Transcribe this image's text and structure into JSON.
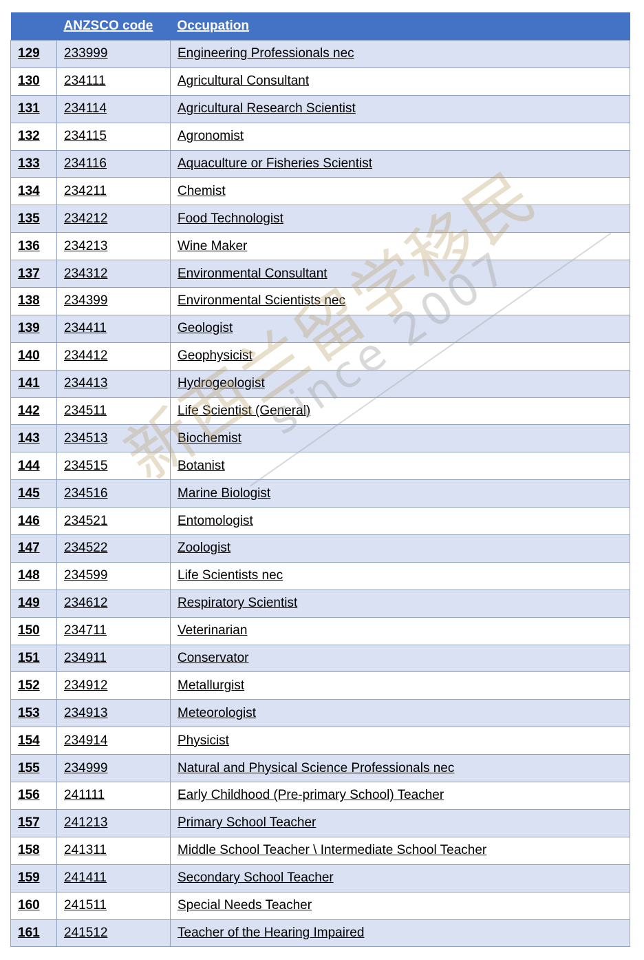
{
  "table": {
    "headers": {
      "number": "",
      "code": "ANZSCO code",
      "occupation": "Occupation"
    },
    "rows": [
      {
        "no": "129",
        "code": "233999",
        "occupation": "Engineering Professionals nec"
      },
      {
        "no": "130",
        "code": "234111",
        "occupation": "Agricultural Consultant"
      },
      {
        "no": "131",
        "code": "234114",
        "occupation": "Agricultural Research Scientist"
      },
      {
        "no": "132",
        "code": "234115",
        "occupation": "Agronomist"
      },
      {
        "no": "133",
        "code": "234116",
        "occupation": "Aquaculture or Fisheries Scientist"
      },
      {
        "no": "134",
        "code": "234211",
        "occupation": "Chemist"
      },
      {
        "no": "135",
        "code": "234212",
        "occupation": "Food Technologist"
      },
      {
        "no": "136",
        "code": "234213",
        "occupation": "Wine Maker"
      },
      {
        "no": "137",
        "code": "234312",
        "occupation": "Environmental Consultant"
      },
      {
        "no": "138",
        "code": "234399",
        "occupation": "Environmental Scientists nec"
      },
      {
        "no": "139",
        "code": "234411",
        "occupation": "Geologist"
      },
      {
        "no": "140",
        "code": "234412",
        "occupation": "Geophysicist"
      },
      {
        "no": "141",
        "code": "234413",
        "occupation": "Hydrogeologist"
      },
      {
        "no": "142",
        "code": "234511",
        "occupation": "Life Scientist (General)"
      },
      {
        "no": "143",
        "code": "234513",
        "occupation": "Biochemist"
      },
      {
        "no": "144",
        "code": "234515",
        "occupation": "Botanist"
      },
      {
        "no": "145",
        "code": "234516",
        "occupation": "Marine Biologist"
      },
      {
        "no": "146",
        "code": "234521",
        "occupation": "Entomologist"
      },
      {
        "no": "147",
        "code": "234522",
        "occupation": "Zoologist"
      },
      {
        "no": "148",
        "code": "234599",
        "occupation": "Life Scientists nec"
      },
      {
        "no": "149",
        "code": "234612",
        "occupation": "Respiratory Scientist"
      },
      {
        "no": "150",
        "code": "234711",
        "occupation": "Veterinarian"
      },
      {
        "no": "151",
        "code": "234911",
        "occupation": "Conservator"
      },
      {
        "no": "152",
        "code": "234912",
        "occupation": "Metallurgist"
      },
      {
        "no": "153",
        "code": "234913",
        "occupation": "Meteorologist"
      },
      {
        "no": "154",
        "code": "234914",
        "occupation": "Physicist"
      },
      {
        "no": "155",
        "code": "234999",
        "occupation": "Natural and Physical Science Professionals nec"
      },
      {
        "no": "156",
        "code": "241111",
        "occupation": "Early Childhood (Pre-primary School) Teacher"
      },
      {
        "no": "157",
        "code": "241213",
        "occupation": "Primary School Teacher"
      },
      {
        "no": "158",
        "code": "241311",
        "occupation": "Middle School Teacher \\ Intermediate School Teacher"
      },
      {
        "no": "159",
        "code": "241411",
        "occupation": "Secondary School Teacher"
      },
      {
        "no": "160",
        "code": "241511",
        "occupation": "Special Needs Teacher"
      },
      {
        "no": "161",
        "code": "241512",
        "occupation": "Teacher of the Hearing Impaired"
      }
    ]
  },
  "watermark": {
    "chinese": "新西兰留学移民",
    "english": "since 2007"
  },
  "colors": {
    "header_bg": "#4472c4",
    "band_bg": "#d9e1f2",
    "border": "#8ea1c2"
  }
}
